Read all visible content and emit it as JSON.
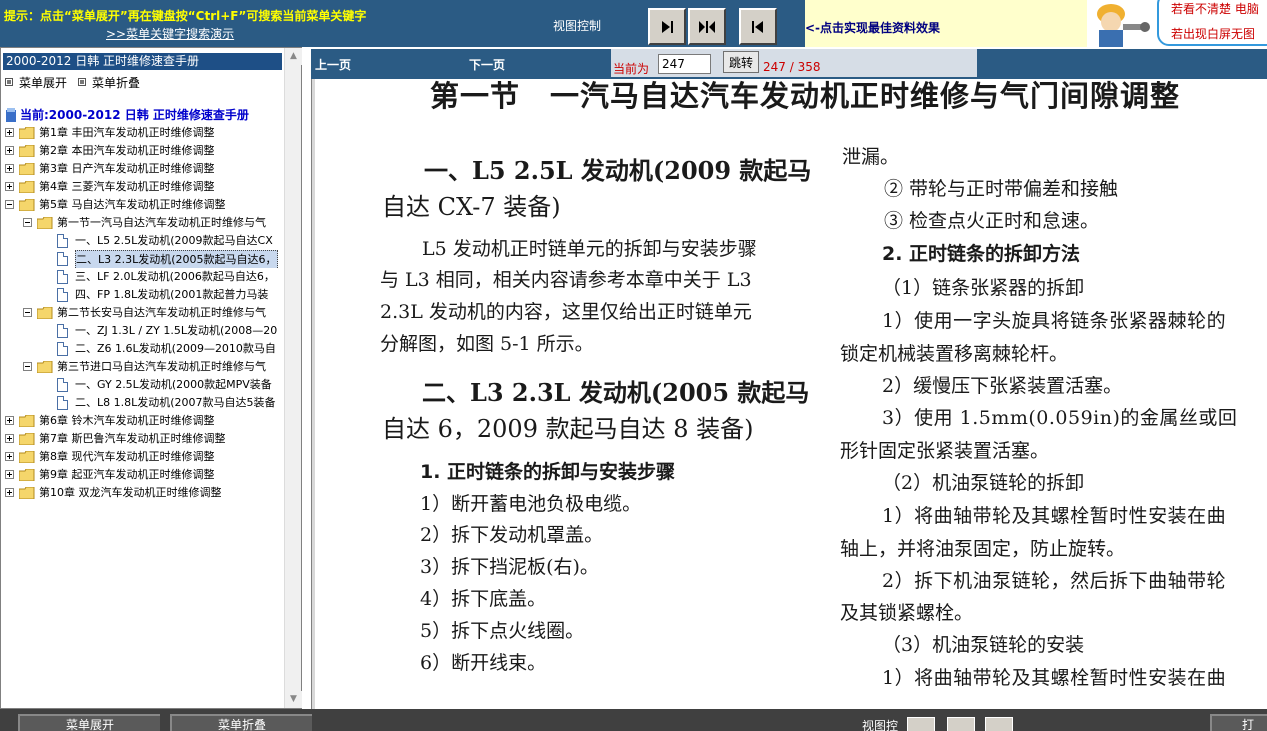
{
  "topbar": {
    "tip_main": "提示：点击“菜单展开”再在键盘按“Ctrl+F”可搜索当前菜单关键字",
    "tip_link": ">>菜单关键字搜索演示",
    "view_control_label": "视图控制",
    "best_view_tip": "<-点击实现最佳资料效果",
    "help_line1": "若看不清楚 电脑",
    "help_line2": "若出现白屏无图"
  },
  "sidebar": {
    "manual_title": "2000-2012 日韩 正时维修速查手册",
    "menu_expand": "菜单展开",
    "menu_collapse": "菜单折叠",
    "tree_root": "当前:2000-2012 日韩 正时维修速查手册",
    "chapters": [
      "第1章 丰田汽车发动机正时维修调整",
      "第2章 本田汽车发动机正时维修调整",
      "第3章 日产汽车发动机正时维修调整",
      "第4章 三菱汽车发动机正时维修调整",
      "第5章 马自达汽车发动机正时维修调整",
      "第6章 铃木汽车发动机正时维修调整",
      "第7章 斯巴鲁汽车发动机正时维修调整",
      "第8章 现代汽车发动机正时维修调整",
      "第9章 起亚汽车发动机正时维修调整",
      "第10章 双龙汽车发动机正时维修调整"
    ],
    "sections": [
      "第一节一汽马自达汽车发动机正时维修与气",
      "第二节长安马自达汽车发动机正时维修与气",
      "第三节进口马自达汽车发动机正时维修与气"
    ],
    "items": [
      "一、L5 2.5L发动机(2009款起马自达CX",
      "二、L3 2.3L发动机(2005款起马自达6，",
      "三、LF 2.0L发动机(2006款起马自达6，",
      "四、FP 1.8L发动机(2001款起普力马装",
      "一、ZJ 1.3L / ZY 1.5L发动机(2008—20",
      "二、Z6 1.6L发动机(2009—2010款马自",
      "一、GY 2.5L发动机(2000款起MPV装备",
      "二、L8 1.8L发动机(2007款马自达5装备"
    ]
  },
  "nav": {
    "prev": "上一页",
    "next": "下一页",
    "current_label": "当前为",
    "page_value": "247",
    "jump": "跳转",
    "page_count": "247 / 358"
  },
  "doc": {
    "section_title": "第一节　一汽马自达汽车发动机正时维修与气门间隙调整",
    "left": [
      "一、L5 2.5L 发动机(2009 款起马",
      "自达 CX-7 装备)",
      "L5 发动机正时链单元的拆卸与安装步骤",
      "与 L3 相同，相关内容请参考本章中关于 L3",
      "2.3L 发动机的内容，这里仅给出正时链单元",
      "分解图，如图 5-1 所示。",
      "二、L3 2.3L 发动机(2005 款起马",
      "自达 6，2009 款起马自达 8 装备)",
      "1. 正时链条的拆卸与安装步骤",
      "1）断开蓄电池负极电缆。",
      "2）拆下发动机罩盖。",
      "3）拆下挡泥板(右)。",
      "4）拆下底盖。",
      "5）拆下点火线圈。",
      "6）断开线束。"
    ],
    "right": [
      "泄漏。",
      "② 带轮与正时带偏差和接触",
      "③ 检查点火正时和怠速。",
      "2. 正时链条的拆卸方法",
      "（1）链条张紧器的拆卸",
      "1）使用一字头旋具将链条张紧器棘轮的",
      "锁定机械装置移离棘轮杆。",
      "2）缓慢压下张紧装置活塞。",
      "3）使用 1.5mm(0.059in)的金属丝或回",
      "形针固定张紧装置活塞。",
      "（2）机油泵链轮的拆卸",
      "1）将曲轴带轮及其螺栓暂时性安装在曲",
      "轴上，并将油泵固定，防止旋转。",
      "2）拆下机油泵链轮，然后拆下曲轴带轮",
      "及其锁紧螺栓。",
      "（3）机油泵链轮的安装",
      "1）将曲轴带轮及其螺栓暂时性安装在曲"
    ]
  },
  "bottombar": {
    "expand": "菜单展开",
    "collapse": "菜单折叠",
    "view_control": "视图控",
    "right_btn": "打"
  },
  "colors": {
    "bar_blue": "#2b5b84",
    "tip_yellow": "#ffff00",
    "selection": "#c8d8ee",
    "page_red": "#cc0000"
  },
  "icons": [
    "folder-icon",
    "page-icon",
    "expand-toggle-icon",
    "collapse-toggle-icon",
    "book-icon"
  ]
}
